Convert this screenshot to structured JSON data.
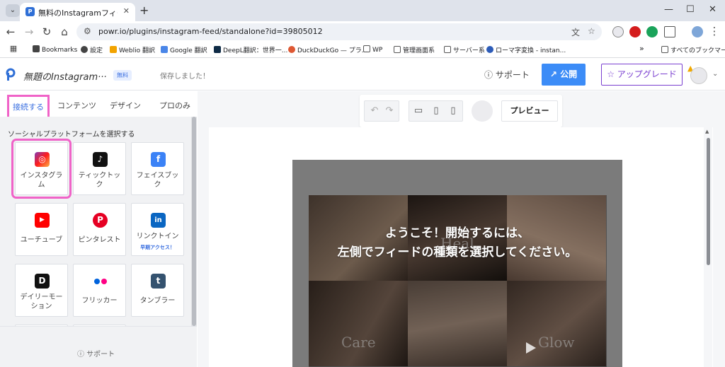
{
  "browser": {
    "tab_title": "無料のInstagramフィードソフトウェア",
    "tab_favicon": "P",
    "url": "powr.io/plugins/instagram-feed/standalone?id=39805012",
    "bookmarks": [
      {
        "label": "Bookmarks",
        "icon": "star-icon",
        "color": "#444444"
      },
      {
        "label": "設定",
        "icon": "gear-icon",
        "color": "#444444"
      },
      {
        "label": "Weblio 翻訳",
        "icon": "weblio-icon",
        "color": "#f2a300"
      },
      {
        "label": "Google 翻訳",
        "icon": "google-translate-icon",
        "color": "#4a86e8"
      },
      {
        "label": "DeepL翻訳：世界一...",
        "icon": "deepl-icon",
        "color": "#0f2b46"
      },
      {
        "label": "DuckDuckGo — プラ...",
        "icon": "duckduckgo-icon",
        "color": "#de5833"
      },
      {
        "label": "WP",
        "icon": "folder-icon",
        "color": "#555555"
      },
      {
        "label": "管理画面系",
        "icon": "folder-icon",
        "color": "#555555"
      },
      {
        "label": "サーバー系",
        "icon": "folder-icon",
        "color": "#555555"
      },
      {
        "label": "ローマ字変換 - instan...",
        "icon": "site-icon",
        "color": "#2d5cb8"
      }
    ],
    "bookmarks_more": "»",
    "all_bookmarks": "すべてのブックマーク"
  },
  "header": {
    "widget_name": "無題のInstagram···",
    "free_badge": "無料",
    "saved_status": "保存しました！",
    "help": "サポート",
    "publish": "公開",
    "upgrade": "アップグレード"
  },
  "sidebar": {
    "tabs": [
      "接続する",
      "コンテンツ",
      "デザイン",
      "プロのみ"
    ],
    "section_title": "ソーシャルプラットフォームを選択する",
    "platforms": [
      {
        "label": "インスタグラム",
        "icon": "instagram-icon",
        "color": "#d6249f",
        "glyph": "◎",
        "sub": ""
      },
      {
        "label": "ティックトック",
        "icon": "tiktok-icon",
        "color": "#111111",
        "glyph": "♪",
        "sub": ""
      },
      {
        "label": "フェイスブック",
        "icon": "facebook-icon",
        "color": "#3b82f6",
        "glyph": "f",
        "sub": ""
      },
      {
        "label": "ユーチューブ",
        "icon": "youtube-icon",
        "color": "#ff0000",
        "glyph": "▶",
        "sub": ""
      },
      {
        "label": "ピンタレスト",
        "icon": "pinterest-icon",
        "color": "#e60023",
        "glyph": "P",
        "sub": ""
      },
      {
        "label": "リンクトイン",
        "icon": "linkedin-icon",
        "color": "#0a66c2",
        "glyph": "in",
        "sub": "早期アクセス！"
      },
      {
        "label": "デイリーモーション",
        "icon": "dailymotion-icon",
        "color": "#111111",
        "glyph": "D",
        "sub": ""
      },
      {
        "label": "フリッカー",
        "icon": "flickr-icon",
        "color": "#ffffff",
        "glyph": "",
        "sub": ""
      },
      {
        "label": "タンブラー",
        "icon": "tumblr-icon",
        "color": "#34526f",
        "glyph": "t",
        "sub": ""
      }
    ],
    "footer_help": "サポート"
  },
  "editor": {
    "preview": "プレビュー"
  },
  "feed": {
    "welcome_line1": "ようこそ！開始するには、",
    "welcome_line2": "左側でフィードの種類を選択してください。",
    "words": [
      "Heal",
      "Care",
      "Glow"
    ]
  }
}
